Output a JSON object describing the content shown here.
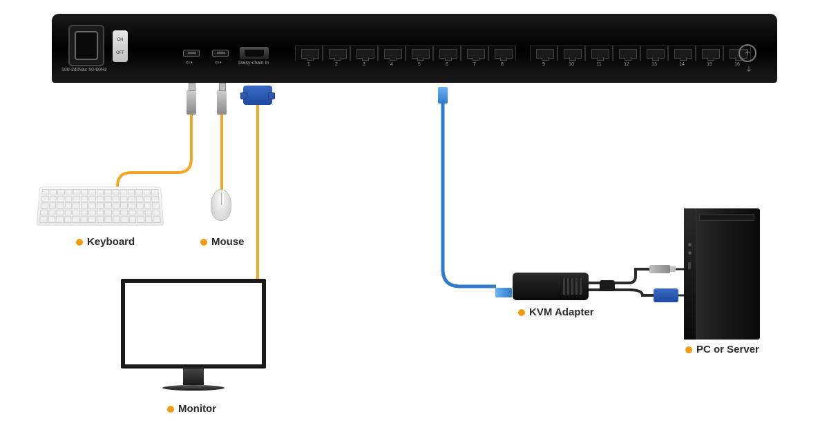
{
  "switch": {
    "power_label": "100-240Vac 50-60Hz",
    "onoff_on": "ON",
    "onoff_off": "OFF",
    "usb_symbol": "⇐•",
    "daisy_label": "Daisy-chain in",
    "ground_symbol": "⏚",
    "port_numbers": [
      "1",
      "2",
      "3",
      "4",
      "5",
      "6",
      "7",
      "8",
      "9",
      "10",
      "11",
      "12",
      "13",
      "14",
      "15",
      "16"
    ]
  },
  "labels": {
    "keyboard": "Keyboard",
    "mouse": "Mouse",
    "monitor": "Monitor",
    "adapter": "KVM Adapter",
    "pc": "PC or Server"
  },
  "colors": {
    "accent": "#f39c12",
    "cable_orange": "#f5a623",
    "cable_blue": "#2e7acc",
    "cable_dark": "#2a2a2a"
  }
}
